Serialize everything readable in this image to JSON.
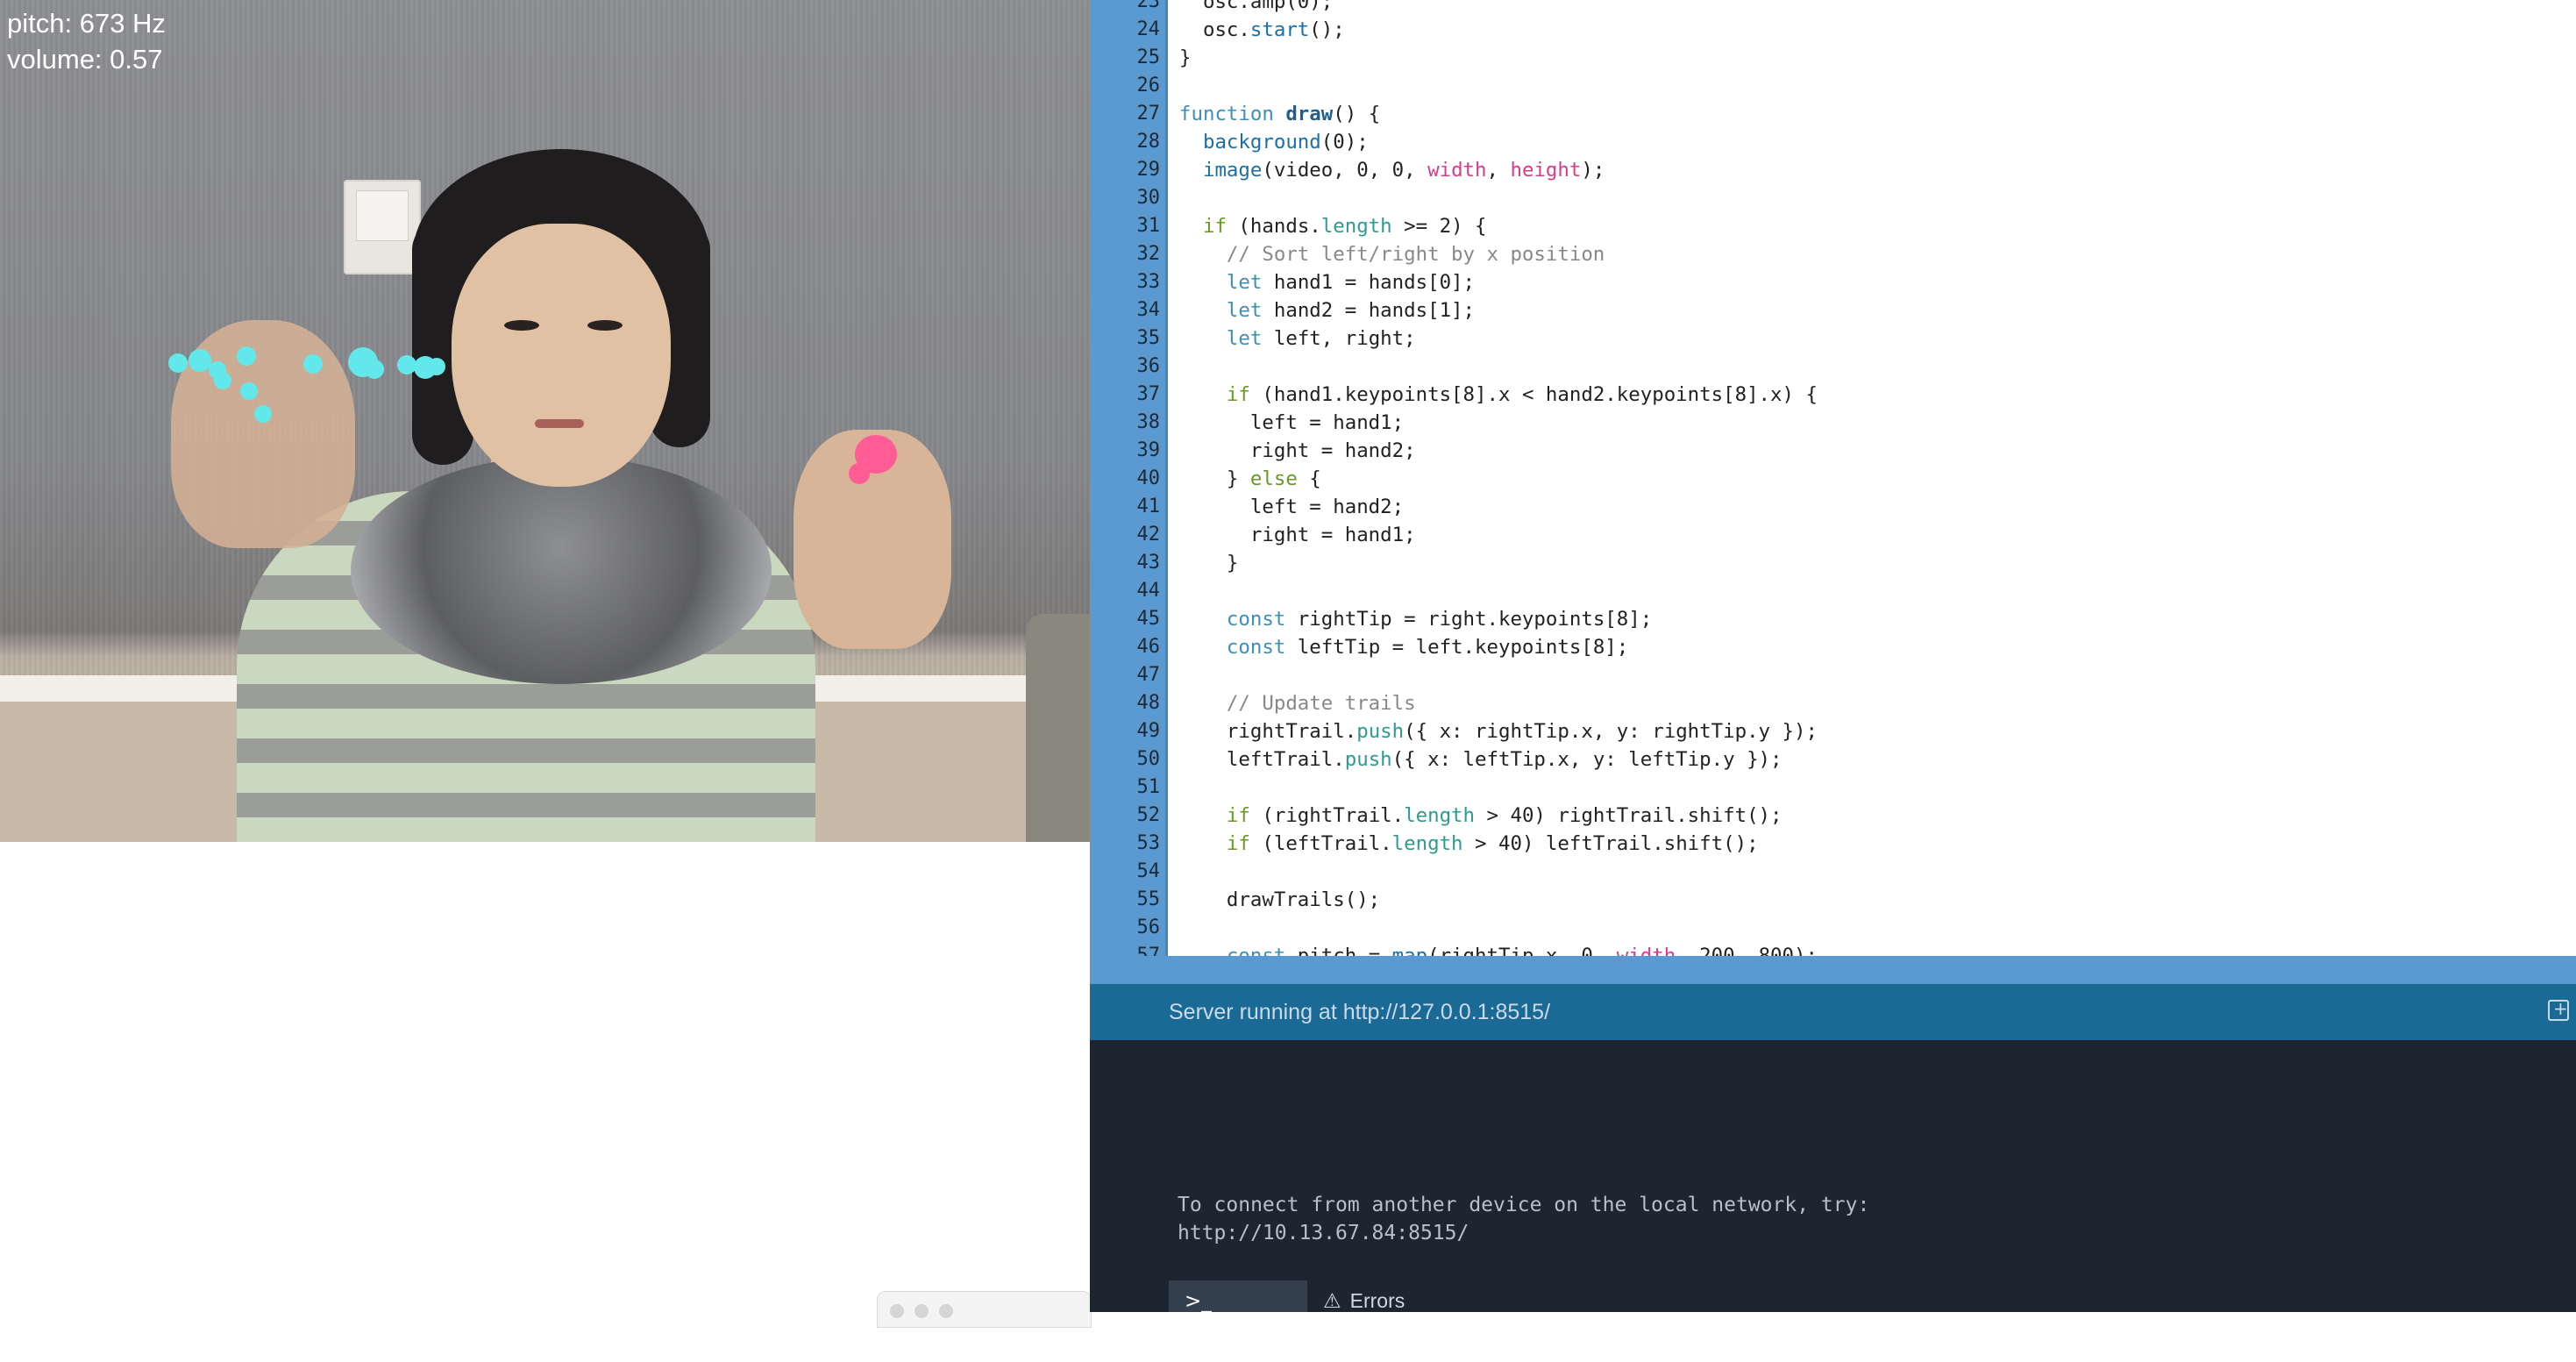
{
  "hud": {
    "pitch": "pitch: 673 Hz",
    "volume": "volume: 0.57"
  },
  "colors": {
    "trail_left": "#62e8ea",
    "trail_right": "#ff5c96",
    "gutter": "#5b9ad0",
    "server_bar": "#1b6a96",
    "console_bg": "#1d2530"
  },
  "editor": {
    "line_numbers": [
      "23",
      "24",
      "25",
      "26",
      "27",
      "28",
      "29",
      "30",
      "31",
      "32",
      "33",
      "34",
      "35",
      "36",
      "37",
      "38",
      "39",
      "40",
      "41",
      "42",
      "43",
      "44",
      "45",
      "46",
      "47",
      "48",
      "49",
      "50",
      "51",
      "52",
      "53",
      "54",
      "55",
      "56",
      "57"
    ]
  },
  "console": {
    "server_status": "Server running at http://127.0.0.1:8515/",
    "output_line1": "To connect from another device on the local network, try:",
    "output_line2": "http://10.13.67.84:8515/",
    "tab_console": "Console",
    "tab_errors": "Errors"
  },
  "icons": {
    "console_tab": "terminal-icon",
    "errors_tab": "warning-icon",
    "server_bar": "new-window-icon"
  }
}
